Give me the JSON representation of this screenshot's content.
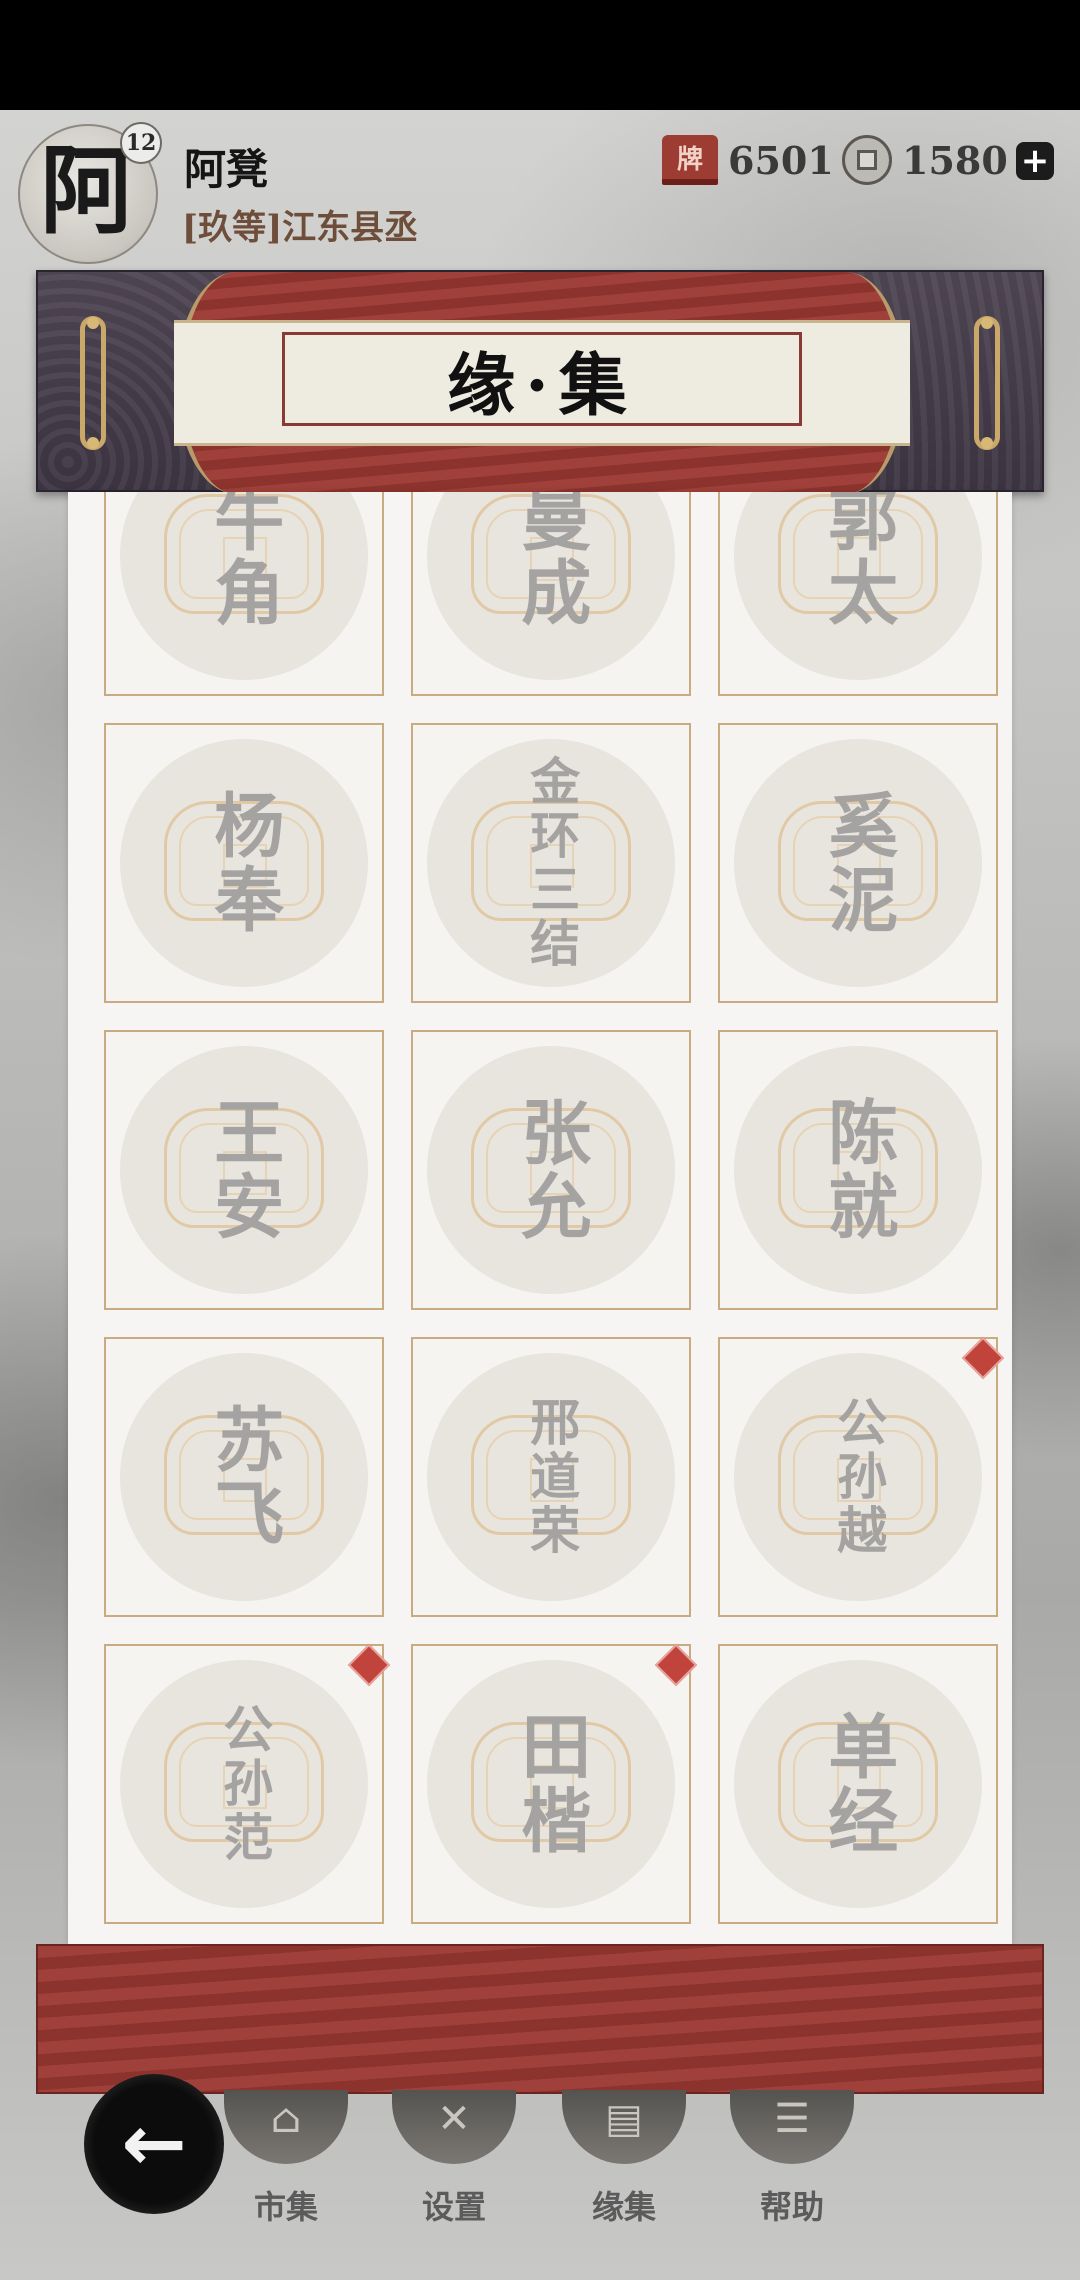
{
  "player": {
    "avatar_char": "阿",
    "level": "12",
    "name": "阿凳",
    "rank": "[玖等]江东县丞"
  },
  "resources": [
    {
      "icon": "red-ticket-icon",
      "value": "6501"
    },
    {
      "icon": "copper-coin-icon",
      "value": "1580"
    }
  ],
  "banner": {
    "title": "缘·集"
  },
  "cards": [
    {
      "name": "牛角",
      "dot": false
    },
    {
      "name": "曼成",
      "dot": false
    },
    {
      "name": "郭太",
      "dot": false
    },
    {
      "name": "杨奉",
      "dot": false
    },
    {
      "name": "金环三结",
      "dot": false
    },
    {
      "name": "奚泥",
      "dot": false
    },
    {
      "name": "王安",
      "dot": false
    },
    {
      "name": "张允",
      "dot": false
    },
    {
      "name": "陈就",
      "dot": false
    },
    {
      "name": "苏飞",
      "dot": false
    },
    {
      "name": "邢道荣",
      "dot": false
    },
    {
      "name": "公孙越",
      "dot": true
    },
    {
      "name": "公孙范",
      "dot": true
    },
    {
      "name": "田楷",
      "dot": true
    },
    {
      "name": "单经",
      "dot": false
    }
  ],
  "nav": {
    "items": [
      {
        "label": "市集",
        "icon": "market-icon",
        "glyph": "⌂"
      },
      {
        "label": "设置",
        "icon": "settings-icon",
        "glyph": "✕"
      },
      {
        "label": "缘集",
        "icon": "book-icon",
        "glyph": "▤"
      },
      {
        "label": "帮助",
        "icon": "scroll-help-icon",
        "glyph": "☰"
      }
    ],
    "back_glyph": "←"
  },
  "colors": {
    "accent_red": "#9d3c33",
    "card_border": "#c8ab80",
    "notify_dot": "#c0443c"
  }
}
